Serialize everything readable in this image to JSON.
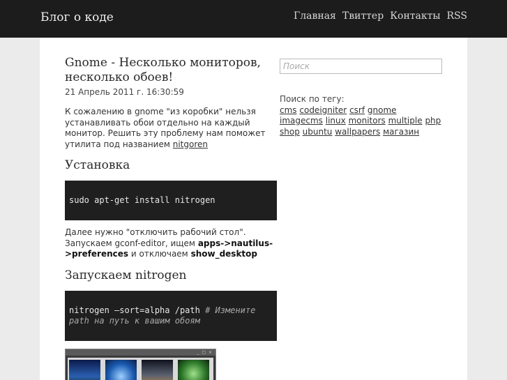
{
  "header": {
    "brand": "Блог о коде",
    "nav": [
      "Главная",
      "Твиттер",
      "Контакты",
      "RSS"
    ]
  },
  "post": {
    "title": "Gnome - Несколько мониторов, несколько обоев!",
    "date": "21 Апрель 2011 г. 16:30:59",
    "intro_text": "К сожалению в gnome \"из коробки\" нельзя устанавливать обои отдельно на каждый монитор. Решить эту проблему нам поможет утилита под названием",
    "intro_link": "nitgoren",
    "section1_title": "Установка",
    "code1": "sudo apt-get install nitrogen",
    "para2_a": "Далее нужно \"отключить рабочий стол\". Запускаем gconf-editor, ищем",
    "para2_b1": "apps->nautilus->preferences",
    "para2_c": "и отключаем",
    "para2_b2": "show_desktop",
    "section2_title": "Запускаем nitrogen",
    "code2_cmd": "nitrogen —sort=alpha /path",
    "code2_comment": "# Измените path на путь к вашим обоям"
  },
  "sidebar": {
    "search_placeholder": "Поиск",
    "tags_label": "Поиск по тегу:",
    "tags": [
      "cms",
      "codeigniter",
      "csrf",
      "gnome",
      "imagecms",
      "linux",
      "monitors",
      "multiple",
      "php",
      "shop",
      "ubuntu",
      "wallpapers",
      "магазин"
    ]
  }
}
